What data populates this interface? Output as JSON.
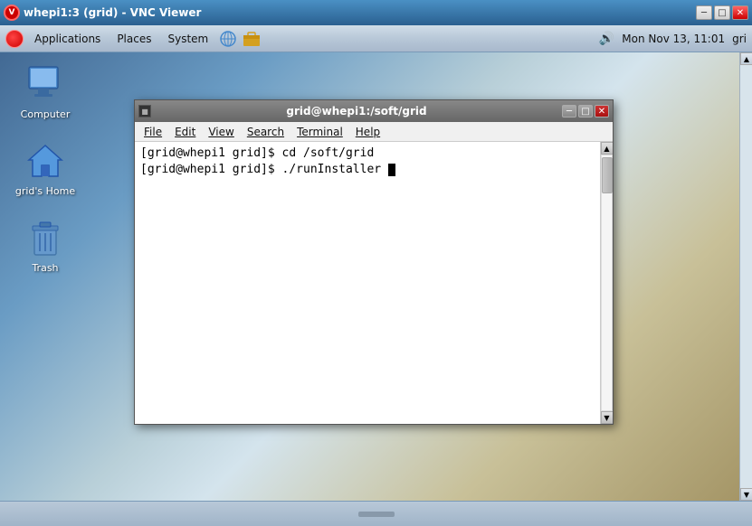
{
  "window": {
    "title": "whepi1:3 (grid) - VNC Viewer",
    "controls": {
      "minimize": "─",
      "maximize": "□",
      "close": "✕"
    }
  },
  "appbar": {
    "items": [
      "Applications",
      "Places",
      "System"
    ],
    "time": "Mon Nov 13, 11:01",
    "user": "gri"
  },
  "desktop_icons": [
    {
      "label": "Computer",
      "type": "computer"
    },
    {
      "label": "grid's Home",
      "type": "home"
    },
    {
      "label": "Trash",
      "type": "trash"
    }
  ],
  "terminal": {
    "title": "grid@whepi1:/soft/grid",
    "icon": "■",
    "controls": {
      "minimize": "─",
      "maximize": "□",
      "close": "✕"
    },
    "menu": [
      "File",
      "Edit",
      "View",
      "Search",
      "Terminal",
      "Help"
    ],
    "lines": [
      "[grid@whepi1 grid]$ cd /soft/grid",
      "[grid@whepi1 grid]$ ./runInstaller "
    ]
  },
  "menu": {
    "file_label": "File",
    "edit_label": "Edit",
    "view_label": "View",
    "search_label": "Search",
    "terminal_label": "Terminal",
    "help_label": "Help"
  }
}
